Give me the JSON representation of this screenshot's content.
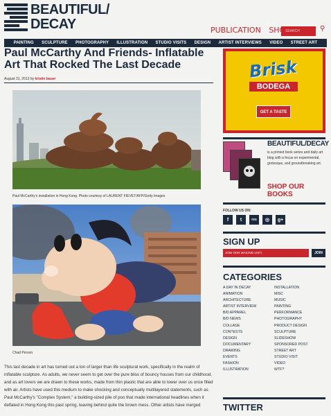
{
  "header": {
    "logo_line1": "BEAUTIFUL/",
    "logo_line2": "DECAY",
    "publication_link": "PUBLICATION",
    "shop_link": "SHOP",
    "search_placeholder": "SEARCH"
  },
  "nav": {
    "items": [
      "PAINTING",
      "SCULPTURE",
      "PHOTOGRAPHY",
      "ILLUSTRATION",
      "STUDIO VISITS",
      "DESIGN",
      "ARTIST INTERVIEWS",
      "VIDEO",
      "STREET ART"
    ]
  },
  "article": {
    "title": "Paul McCarthy And Friends- Inflatable Art That Rocked The Last Decade",
    "date": "August 31, 2013",
    "by": "by",
    "author": "kristin bauer",
    "caption1": "Paul McCarthy's installation in Hong Kong. Photo courtesy of LAURENT FIEVET/AFP/Getty Images",
    "caption2": "Chad Person",
    "body": "This last decade in art has turned out a ton of larger than life sculptural work, specifically in the realm of inflatable sculpture.  As adults, we never seem to get over the pure bliss of bouncy houses from our childhood, and as art lovers we are drawn to these works, made from thin plastic that are able to tower over us once filled with air.  Artists have used this medium to make shocking and conceptually multilayered statements, such as Paul McCarthy's \"Complex System,\" a building-sized pile of poo that made international headlines when it deflated in Hong Kong this past spring, leaving behind quite the brown mess.  Other artists have merged"
  },
  "ad": {
    "brand": "Brisk",
    "sub": "BODEGA",
    "cta": "GET A TASTE"
  },
  "sidebar": {
    "books_title": "BEAUTIFUL/DECAY",
    "books_desc": "is a printed book series and daily art blog with a focus on experimental, grotesque, and groundbreaking art.",
    "shop_books": "SHOP OUR BOOKS",
    "follow_label": "FOLLOW US ON:",
    "social": [
      "f",
      "t",
      "rss",
      "◎",
      "g+"
    ],
    "signup_title": "SIGN UP",
    "signup_placeholder": "JOIN OUR MAILING LIST!",
    "signup_button": "JOIN",
    "categories_title": "CATEGORIES",
    "categories_left": [
      "A Day In Decay",
      "Animation",
      "Architecture",
      "Artist Interview",
      "B/D Apparel",
      "B/D News",
      "Collage",
      "Contests",
      "Design",
      "Documentary",
      "Drawing",
      "Events",
      "Fashion",
      "Illustration"
    ],
    "categories_right": [
      "Installation",
      "Misc",
      "Music",
      "Painting",
      "Performance",
      "Photography",
      "Product Design",
      "Sculpture",
      "Slideshow",
      "Sponsored Post",
      "Street Art",
      "Studio Visit",
      "Video",
      "WTF?"
    ],
    "twitter_title": "TWITTER"
  },
  "colors": {
    "navy": "#1b2b3b",
    "red": "#c8252c",
    "ad_yellow": "#f3c800"
  }
}
